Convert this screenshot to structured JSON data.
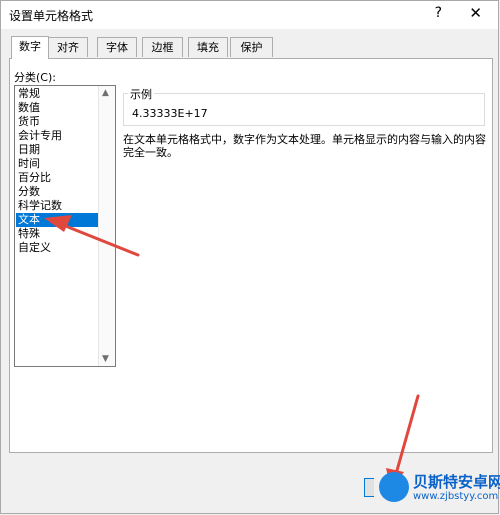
{
  "dialog": {
    "title": "设置单元格格式",
    "help_label": "?",
    "close_label": "✕"
  },
  "tabs": [
    {
      "label": "数字",
      "active": true
    },
    {
      "label": "对齐",
      "active": false
    },
    {
      "label": "字体",
      "active": false
    },
    {
      "label": "边框",
      "active": false
    },
    {
      "label": "填充",
      "active": false
    },
    {
      "label": "保护",
      "active": false
    }
  ],
  "category": {
    "label": "分类(C):",
    "items": [
      "常规",
      "数值",
      "货币",
      "会计专用",
      "日期",
      "时间",
      "百分比",
      "分数",
      "科学记数",
      "文本",
      "特殊",
      "自定义"
    ],
    "selected": "文本"
  },
  "sample": {
    "label": "示例",
    "value": "4.33333E+17"
  },
  "description": "在文本单元格格式中，数字作为文本处理。单元格显示的内容与输入的内容完全一致。",
  "watermark": {
    "name": "贝斯特安卓网",
    "url": "www.zjbstyy.com"
  },
  "colors": {
    "selection": "#0078d7",
    "annotation_arrow": "#e0483e"
  }
}
